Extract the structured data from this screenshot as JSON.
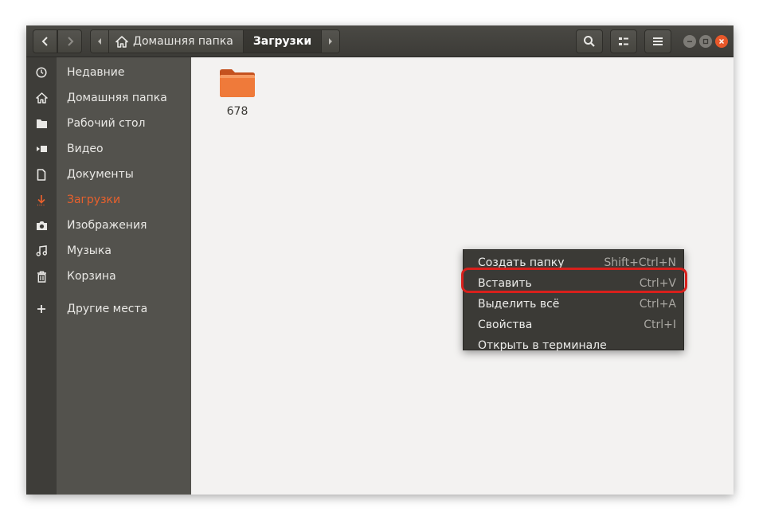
{
  "header": {
    "path": [
      {
        "label": "Домашняя папка"
      },
      {
        "label": "Загрузки"
      }
    ]
  },
  "sidebar": {
    "items": [
      {
        "label": "Недавние",
        "icon": "clock-icon"
      },
      {
        "label": "Домашняя папка",
        "icon": "home-icon"
      },
      {
        "label": "Рабочий стол",
        "icon": "folder-icon"
      },
      {
        "label": "Видео",
        "icon": "video-icon"
      },
      {
        "label": "Документы",
        "icon": "document-icon"
      },
      {
        "label": "Загрузки",
        "icon": "download-icon",
        "active": true
      },
      {
        "label": "Изображения",
        "icon": "camera-icon"
      },
      {
        "label": "Музыка",
        "icon": "music-icon"
      },
      {
        "label": "Корзина",
        "icon": "trash-icon"
      },
      {
        "label": "Другие места",
        "icon": "plus-icon"
      }
    ]
  },
  "content": {
    "files": [
      {
        "name": "678",
        "type": "folder"
      }
    ]
  },
  "context_menu": {
    "items": [
      {
        "label": "Создать папку",
        "shortcut": "Shift+Ctrl+N"
      },
      {
        "label": "Вставить",
        "shortcut": "Ctrl+V",
        "highlighted": true
      },
      {
        "label": "Выделить всё",
        "shortcut": "Ctrl+A"
      },
      {
        "label": "Свойства",
        "shortcut": "Ctrl+I"
      },
      {
        "label": "Открыть в терминале",
        "shortcut": ""
      }
    ]
  },
  "colors": {
    "accent": "#e8602c",
    "highlight_ring": "#d8201c",
    "sidebar_bg": "#53524d",
    "header_bg": "#3c3b37"
  }
}
